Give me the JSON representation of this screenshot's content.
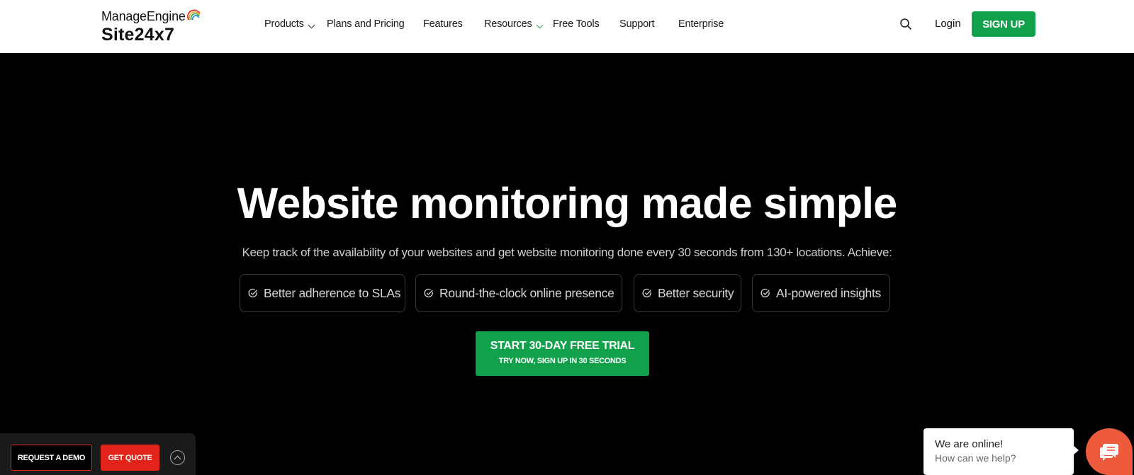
{
  "header": {
    "logo_top": "ManageEngine",
    "logo_bottom": "Site24x7",
    "nav": [
      {
        "label": "Products",
        "has_dropdown": true
      },
      {
        "label": "Plans and Pricing"
      },
      {
        "label": "Features"
      },
      {
        "label": "Resources",
        "has_dropdown": true
      },
      {
        "label": "Free Tools"
      },
      {
        "label": "Support"
      },
      {
        "label": "Enterprise"
      }
    ],
    "search_icon": "search-icon",
    "login_label": "Login",
    "signup_label": "SIGN UP"
  },
  "hero": {
    "title": "Website monitoring made simple",
    "subtitle": "Keep track of the availability of your websites and get website monitoring done every 30 seconds from 130+ locations. Achieve:",
    "chips": [
      {
        "label": "Better adherence to SLAs",
        "icon": "check-circle-icon"
      },
      {
        "label": "Round-the-clock online presence",
        "icon": "check-circle-icon"
      },
      {
        "label": "Better security",
        "icon": "check-circle-icon"
      },
      {
        "label": "AI-powered insights",
        "icon": "check-circle-icon"
      }
    ],
    "cta_line1": "START 30-DAY FREE TRIAL",
    "cta_line2": "TRY NOW, SIGN UP IN 30 SECONDS"
  },
  "bottom_bar": {
    "demo_label": "REQUEST A DEMO",
    "quote_label": "GET QUOTE",
    "toggle_icon": "chevron-up-icon"
  },
  "chat": {
    "line1": "We are online!",
    "line2": "How can we help?",
    "icon": "chat-icon"
  },
  "colors": {
    "brand_green": "#12a14b",
    "accent_red": "#e2231a",
    "chat_orange": "#ee5a3c",
    "background": "#000000"
  }
}
